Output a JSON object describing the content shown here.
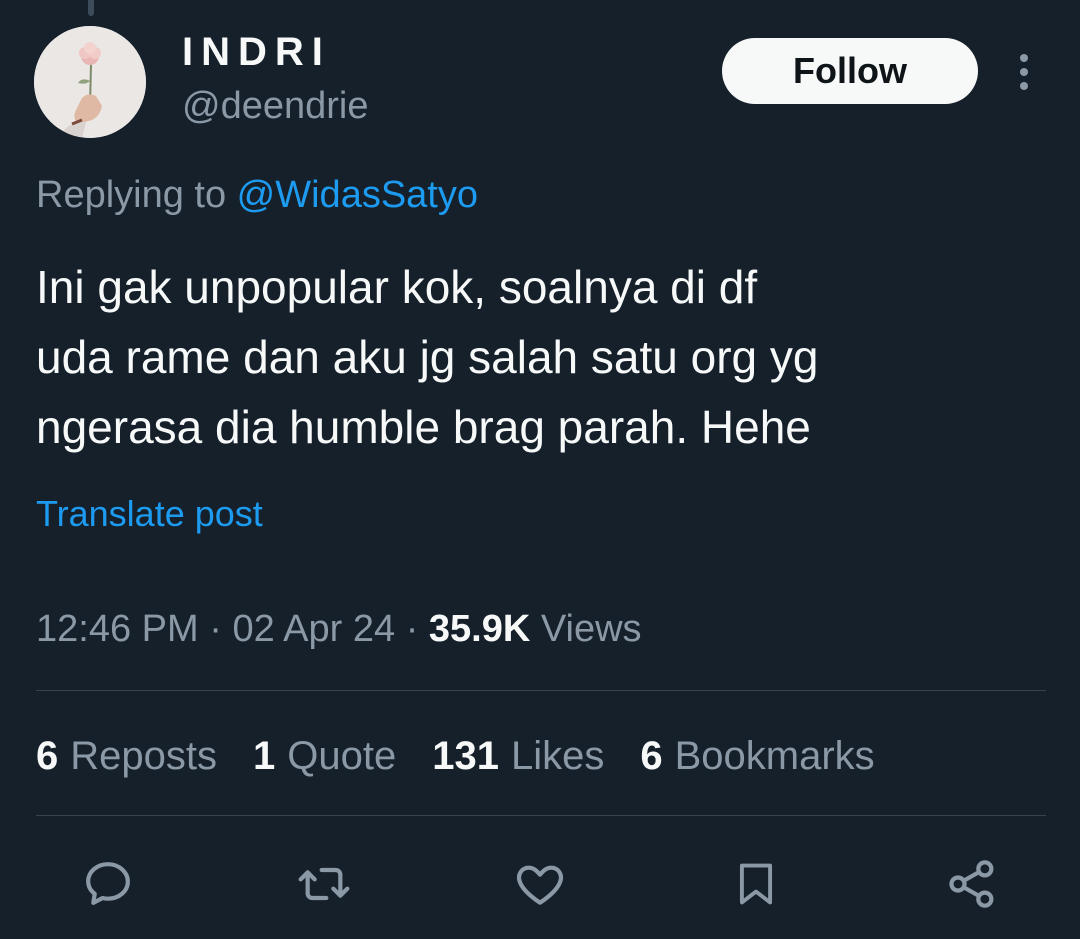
{
  "author": {
    "display_name": "INDRI",
    "handle": "@deendrie",
    "avatar_icon": "avatar-rose-in-hand"
  },
  "follow_label": "Follow",
  "more_icon": "more-vertical-icon",
  "reply_context": {
    "prefix": "Replying to ",
    "mention": "@WidasSatyo"
  },
  "tweet": {
    "lines": [
      "Ini gak unpopular kok, soalnya di df",
      "uda rame dan aku jg salah satu org yg",
      "ngerasa dia humble brag parah. Hehe"
    ],
    "translate_label": "Translate post"
  },
  "meta": {
    "time": "12:46 PM",
    "separator": "·",
    "date": "02 Apr 24",
    "views_count": "35.9K",
    "views_label": "Views"
  },
  "stats": [
    {
      "count": "6",
      "label": "Reposts"
    },
    {
      "count": "1",
      "label": "Quote"
    },
    {
      "count": "131",
      "label": "Likes"
    },
    {
      "count": "6",
      "label": "Bookmarks"
    }
  ],
  "actions": [
    {
      "icon": "reply-icon"
    },
    {
      "icon": "repost-icon"
    },
    {
      "icon": "like-icon"
    },
    {
      "icon": "bookmark-icon"
    },
    {
      "icon": "share-icon"
    }
  ],
  "colors": {
    "background": "#15202b",
    "text_primary": "#f7f9f9",
    "text_secondary": "#8b98a5",
    "accent": "#1d9bf0",
    "divider": "#38444d"
  }
}
